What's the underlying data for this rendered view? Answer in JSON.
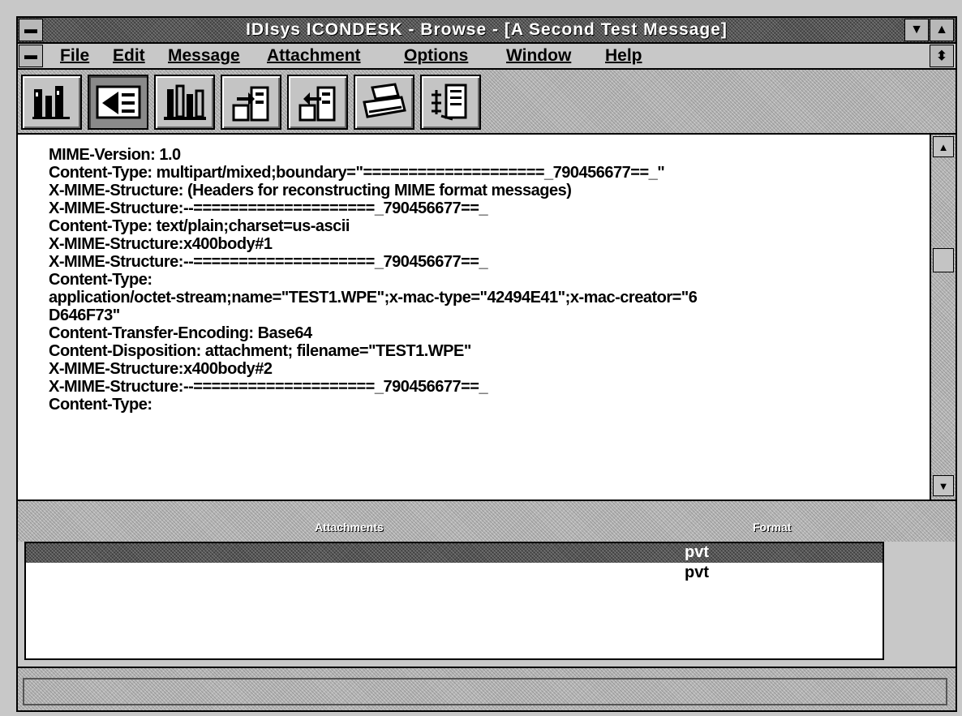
{
  "window": {
    "title": "IDIsys ICONDESK - Browse - [A Second Test Message]"
  },
  "menubar": {
    "items": [
      {
        "label": "File"
      },
      {
        "label": "Edit"
      },
      {
        "label": "Message"
      },
      {
        "label": "Attachment"
      },
      {
        "label": "Options"
      },
      {
        "label": "Window"
      },
      {
        "label": "Help"
      }
    ]
  },
  "toolbar": {
    "buttons": [
      {
        "icon": "exit-building-icon"
      },
      {
        "icon": "message-view-icon"
      },
      {
        "icon": "attachments-tools-icon"
      },
      {
        "icon": "export-attachment-icon"
      },
      {
        "icon": "import-attachment-icon"
      },
      {
        "icon": "print-icon"
      },
      {
        "icon": "structure-icon"
      }
    ]
  },
  "message": {
    "lines": [
      "MIME-Version: 1.0",
      "Content-Type: multipart/mixed;boundary=\"====================_790456677==_\"",
      "X-MIME-Structure: (Headers for reconstructing MIME format messages)",
      "X-MIME-Structure:--====================_790456677==_",
      "Content-Type: text/plain;charset=us-ascii",
      "X-MIME-Structure:x400body#1",
      "X-MIME-Structure:--====================_790456677==_",
      "Content-Type:",
      "application/octet-stream;name=\"TEST1.WPE\";x-mac-type=\"42494E41\";x-mac-creator=\"6",
      "D646F73\"",
      "Content-Transfer-Encoding: Base64",
      "Content-Disposition: attachment; filename=\"TEST1.WPE\"",
      "X-MIME-Structure:x400body#2",
      "X-MIME-Structure:--====================_790456677==_",
      "Content-Type:"
    ]
  },
  "attachments": {
    "header_attachments": "Attachments",
    "header_format": "Format",
    "rows": [
      {
        "name": "",
        "format": "pvt",
        "selected": true
      },
      {
        "name": "",
        "format": "pvt",
        "selected": false
      }
    ]
  }
}
